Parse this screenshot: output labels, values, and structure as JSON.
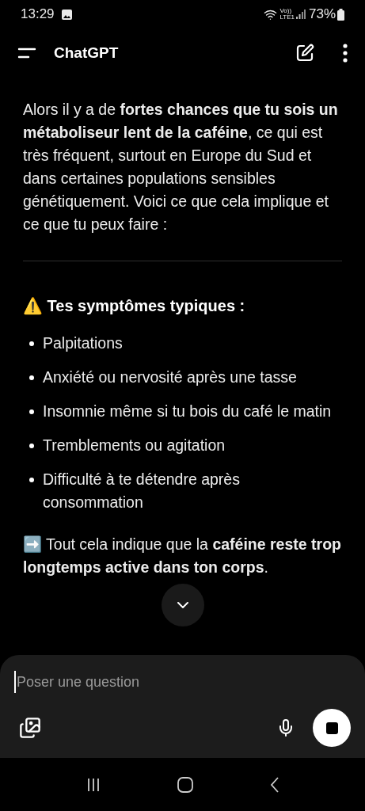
{
  "status_bar": {
    "time": "13:29",
    "volte": "Vo))",
    "lte": "LTE1",
    "battery": "73%"
  },
  "header": {
    "title": "ChatGPT"
  },
  "message": {
    "intro": "Alors il y a de **fortes chances que tu sois un métaboliseur lent de la caféine**, ce qui est très fréquent, surtout en Europe du Sud et dans certaines populations sensibles génétiquement. Voici ce que cela implique et ce que tu peux faire :",
    "heading": "⚠️ Tes symptômes typiques :",
    "bullets": [
      "Palpitations",
      "Anxiété ou nervosité après une tasse",
      "Insomnie même si tu bois du café le matin",
      "Tremblements ou agitation",
      "Difficulté à te détendre après consommation"
    ],
    "conclusion": "➡️ Tout cela indique que la **caféine reste trop longtemps active dans ton corps**."
  },
  "composer": {
    "placeholder": "Poser une question"
  }
}
